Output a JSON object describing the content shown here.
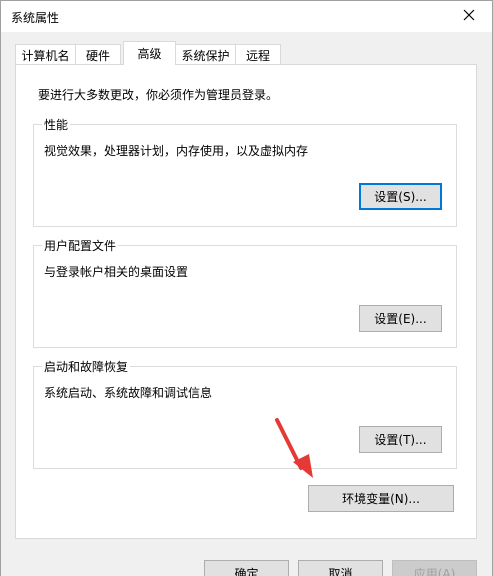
{
  "window": {
    "title": "系统属性",
    "close_icon": "close-icon"
  },
  "tabs": [
    {
      "label": "计算机名",
      "active": false
    },
    {
      "label": "硬件",
      "active": false
    },
    {
      "label": "高级",
      "active": true
    },
    {
      "label": "系统保护",
      "active": false
    },
    {
      "label": "远程",
      "active": false
    }
  ],
  "advanced": {
    "admin_note": "要进行大多数更改，你必须作为管理员登录。",
    "performance": {
      "title": "性能",
      "description": "视觉效果，处理器计划，内存使用，以及虚拟内存",
      "button": "设置(S)..."
    },
    "user_profiles": {
      "title": "用户配置文件",
      "description": "与登录帐户相关的桌面设置",
      "button": "设置(E)..."
    },
    "startup_recovery": {
      "title": "启动和故障恢复",
      "description": "系统启动、系统故障和调试信息",
      "button": "设置(T)..."
    },
    "env_button": "环境变量(N)..."
  },
  "footer": {
    "ok": "确定",
    "cancel": "取消",
    "apply": "应用(A)"
  },
  "colors": {
    "annotation_arrow": "#e53935",
    "focus_border": "#0078d7"
  }
}
